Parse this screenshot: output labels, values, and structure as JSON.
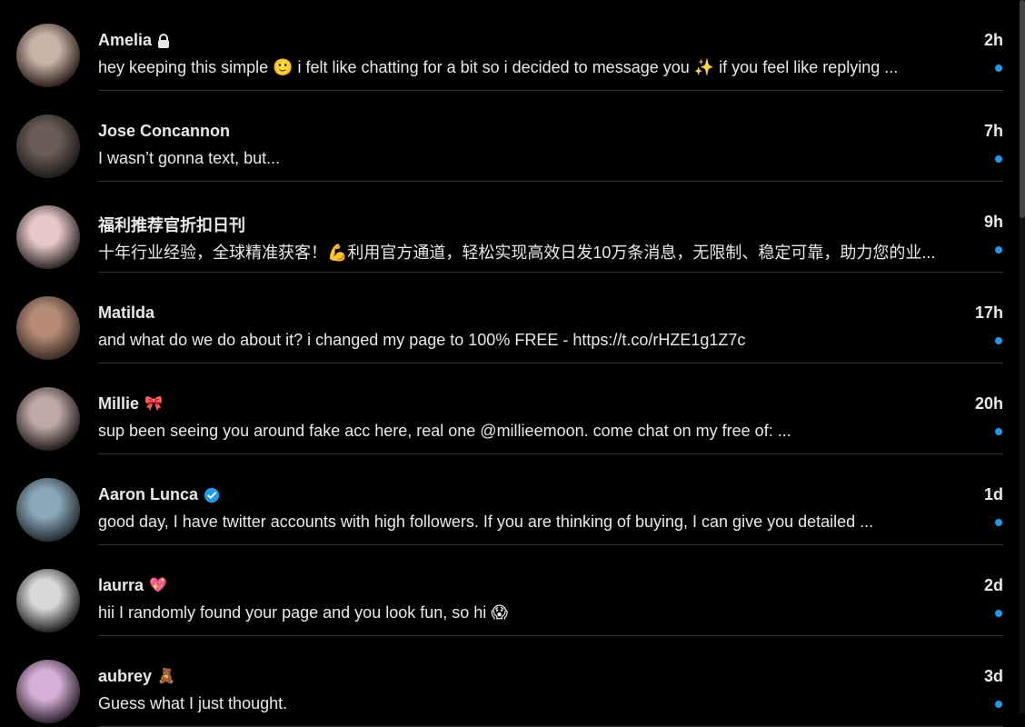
{
  "conversations": [
    {
      "name": "Amelia",
      "badge": "lock",
      "time": "2h",
      "preview": "hey keeping this simple 🙂  i felt like chatting for a bit so i decided to message you ✨  if you feel like replying ...",
      "unread": true,
      "avatar_colors": [
        "#c8b4a6",
        "#2a1d1a"
      ]
    },
    {
      "name": "Jose Concannon",
      "badge": "",
      "time": "7h",
      "preview": "I wasn’t gonna text, but...",
      "unread": true,
      "avatar_colors": [
        "#6b5d55",
        "#1c1a19"
      ]
    },
    {
      "name": "福利推荐官折扣日刊",
      "badge": "",
      "time": "9h",
      "preview": "十年行业经验，全球精准获客！💪利用官方通道，轻松实现高效日发10万条消息，无限制、稳定可靠，助力您的业...",
      "unread": true,
      "avatar_colors": [
        "#e7c8c8",
        "#2a2323"
      ]
    },
    {
      "name": "Matilda",
      "badge": "",
      "time": "17h",
      "preview": "and what do we do about it? i changed my page to  100% FREE - https://t.co/rHZE1g1Z7c",
      "unread": true,
      "avatar_colors": [
        "#b58b76",
        "#3a2a24"
      ]
    },
    {
      "name": "Millie",
      "badge": "🎀",
      "time": "20h",
      "preview": "sup been seeing you around fake acc here, real one @millieemoon. come chat on my free of: ...",
      "unread": true,
      "avatar_colors": [
        "#bfa9a6",
        "#201a1a"
      ]
    },
    {
      "name": "Aaron Lunca",
      "badge": "verified",
      "time": "1d",
      "preview": "good day, I have twitter accounts with high followers. If you are thinking of buying, I can give you detailed ...",
      "unread": true,
      "avatar_colors": [
        "#8aa6b8",
        "#222b30"
      ]
    },
    {
      "name": "laurra",
      "badge": "💖",
      "time": "2d",
      "preview": "hii I randomly found your page and you look fun, so hi 😱",
      "unread": true,
      "avatar_colors": [
        "#d8d8d8",
        "#1d1d1d"
      ]
    },
    {
      "name": "aubrey",
      "badge": "🧸",
      "time": "3d",
      "preview": "Guess what I just thought.",
      "unread": true,
      "avatar_colors": [
        "#d7b0d8",
        "#2b1f2c"
      ]
    }
  ],
  "colors": {
    "accent": "#1d9bf0",
    "background": "#000000",
    "divider": "#2f3336",
    "text": "#e7e9ea"
  }
}
